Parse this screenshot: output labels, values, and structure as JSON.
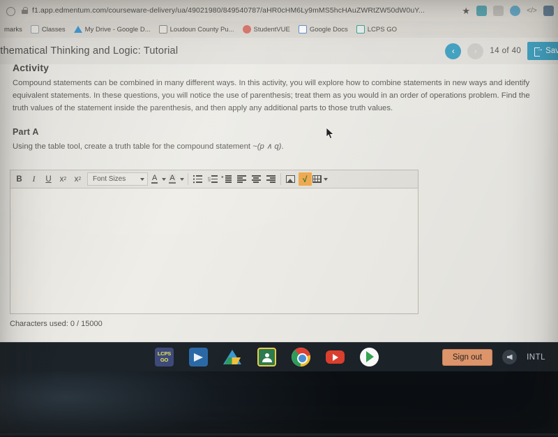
{
  "browser": {
    "url": "f1.app.edmentum.com/courseware-delivery/ua/49021980/849540787/aHR0cHM6Ly9mMS5hcHAuZWRtZW50dW0uY...",
    "home_icon": "home-icon",
    "lock_icon": "lock-icon",
    "star_icon": "★",
    "extensions": [
      {
        "name": "extension-icon-1"
      },
      {
        "name": "extension-icon-2"
      },
      {
        "name": "extension-icon-3"
      },
      {
        "name": "extension-icon-4"
      },
      {
        "name": "extension-icon-5"
      }
    ],
    "bookmarks": [
      {
        "label": "marks",
        "icon": "bookmarks-folder-icon"
      },
      {
        "label": "Classes",
        "icon": "classes-icon"
      },
      {
        "label": "My Drive - Google D...",
        "icon": "google-drive-icon"
      },
      {
        "label": "Loudoun County Pu...",
        "icon": "library-icon"
      },
      {
        "label": "StudentVUE",
        "icon": "studentvue-icon"
      },
      {
        "label": "Google Docs",
        "icon": "google-docs-icon"
      },
      {
        "label": "LCPS GO",
        "icon": "lcps-go-icon"
      }
    ]
  },
  "page": {
    "title": "athematical Thinking and Logic: Tutorial",
    "nav": {
      "prev_icon": "‹",
      "next_icon": "›",
      "counter": "14  of  40",
      "save_label": "Sav",
      "save_icon": "save-exit-icon"
    },
    "activity": {
      "heading": "Activity",
      "paragraph": "Compound statements can be combined in many different ways. In this activity, you will explore how to combine statements in new ways and identify equivalent statements. In these questions, you will notice the use of parenthesis; treat them as you would in an order of operations problem. Find the truth values of the statement inside the parenthesis, and then apply any additional parts to those truth values.",
      "part_heading": "Part A",
      "part_prompt_before": "Using the table tool, create a truth table for the compound statement ",
      "part_prompt_math": "~(p ∧ q)",
      "part_prompt_after": "."
    },
    "editor": {
      "toolbar": {
        "bold": "B",
        "italic": "I",
        "underline": "U",
        "superscript_base": "x",
        "superscript_exp": "2",
        "subscript_base": "x",
        "subscript_exp": "2",
        "font_sizes_label": "Font Sizes",
        "text_color": "A",
        "highlight_color": "A",
        "bulleted_list": "bulleted-list-icon",
        "numbered_list": "numbered-list-icon",
        "indent": "indent-icon",
        "align_left": "align-left-icon",
        "align_center": "align-center-icon",
        "align_right": "align-right-icon",
        "insert_image": "insert-image-icon",
        "equation": "√",
        "insert_table": "insert-table-icon"
      },
      "content": "",
      "char_count": "Characters used: 0 / 15000"
    }
  },
  "shelf": {
    "apps": [
      {
        "name": "lcps-go",
        "label": "LCPS\nGO"
      },
      {
        "name": "blue-app",
        "label": ""
      },
      {
        "name": "google-drive",
        "label": ""
      },
      {
        "name": "google-classroom",
        "label": ""
      },
      {
        "name": "google-chrome",
        "label": ""
      },
      {
        "name": "youtube",
        "label": ""
      },
      {
        "name": "google-play",
        "label": ""
      }
    ],
    "sign_out_label": "Sign out",
    "mute_icon": "volume-mute-icon",
    "intl_label": "INTL",
    "time": ""
  },
  "colors": {
    "accent_teal": "#3a9fc0",
    "sign_out_orange": "#e59a6e",
    "equation_highlight": "#f0a94a",
    "shelf_dark": "#1c2329",
    "page_bg": "#ecebe6"
  }
}
